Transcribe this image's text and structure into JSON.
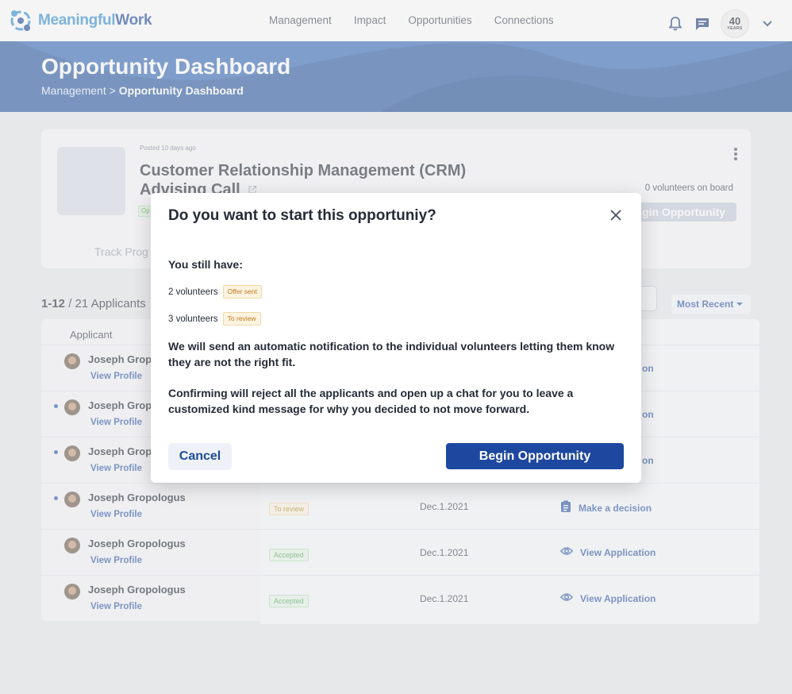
{
  "brand": {
    "name_part1": "Meaningful",
    "name_part2": "Work"
  },
  "nav": {
    "links": [
      "Management",
      "Impact",
      "Opportunities",
      "Connections"
    ],
    "badge_big": "40",
    "badge_small": "YEARS"
  },
  "banner": {
    "title": "Opportunity Dashboard",
    "breadcrumb_parent": "Management",
    "breadcrumb_sep": ">",
    "breadcrumb_current": "Opportunity Dashboard"
  },
  "opportunity": {
    "posted": "Posted 10 days ago",
    "title": "Customer Relationship Management (CRM) Advising Call",
    "status_fragment": "Op",
    "volunteers_on_board": "0 volunteers on board",
    "begin_fragment": "gin Opportunity",
    "track_progress": "Track Prog"
  },
  "applicants": {
    "range": "1-12",
    "total": "/ 21 Applicants",
    "sort_label": "Most Recent",
    "column_applicant": "Applicant",
    "rows": [
      {
        "name": "Joseph Gropologus",
        "profile": "View Profile",
        "status": "",
        "date": "",
        "action": "",
        "unread": false
      },
      {
        "name": "Joseph Gropologus",
        "profile": "View Profile",
        "status": "",
        "date": "",
        "action": "",
        "unread": true
      },
      {
        "name": "Joseph Gropologus",
        "profile": "View Profile",
        "status": "",
        "date": "",
        "action": "",
        "unread": true
      },
      {
        "name": "Joseph Gropologus",
        "profile": "View Profile",
        "status": "To review",
        "date": "Dec.1.2021",
        "action": "Make a decision",
        "unread": true
      },
      {
        "name": "Joseph Gropologus",
        "profile": "View Profile",
        "status": "Accepted",
        "date": "Dec.1.2021",
        "action": "View Application",
        "unread": false
      },
      {
        "name": "Joseph Gropologus",
        "profile": "View Profile",
        "status": "Accepted",
        "date": "Dec.1.2021",
        "action": "View Application",
        "unread": false
      }
    ],
    "visible_name_fragment": "Joseph Gropo",
    "action_fragment": "on"
  },
  "modal": {
    "title": "Do you want  to start this opportuniy?",
    "still_have": "You still have:",
    "line1_count": "2 volunteers",
    "line1_badge": "Offer sent",
    "line2_count": "3 volunteers",
    "line2_badge": "To review",
    "para1": "We will send an automatic notification to the individual volunteers letting them know they are not the right fit.",
    "para2": "Confirming will  reject all the applicants and open up a chat for you to leave a customized kind message for why you decided to not move forward.",
    "cancel": "Cancel",
    "confirm": "Begin Opportunity"
  },
  "colors": {
    "brand_blue": "#1e47a0",
    "banner_blue": "#2a5aa0",
    "link_blue": "#2f58a8",
    "accepted_green": "#4aa84f",
    "review_amber": "#b58a2a"
  }
}
